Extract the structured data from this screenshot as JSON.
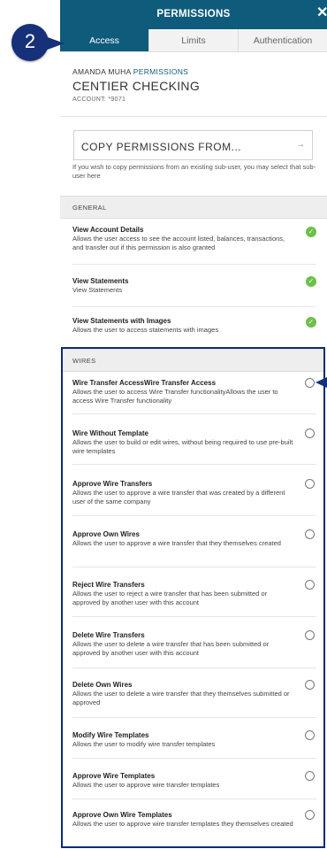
{
  "header": {
    "title": "PERMISSIONS",
    "close_glyph": "✕"
  },
  "tabs": [
    {
      "label": "Access",
      "active": true
    },
    {
      "label": "Limits",
      "active": false
    },
    {
      "label": "Authentication",
      "active": false
    }
  ],
  "user": {
    "name": "AMANDA MUHA",
    "permissions_word": "PERMISSIONS"
  },
  "account": {
    "name": "CENTIER CHECKING",
    "number": "ACCOUNT: *9071"
  },
  "copy": {
    "label": "COPY PERMISSIONS FROM...",
    "arrow": "→",
    "help": "If you wish to copy permissions from an existing sub-user, you may select that sub-user here"
  },
  "sections": {
    "general": {
      "title": "GENERAL",
      "items": [
        {
          "title": "View Account Details",
          "desc": "Allows the user access to see the account listed, balances, transactions, and transfer out if this permission is also granted",
          "checked": true
        },
        {
          "title": "View Statements",
          "desc": "View Statements",
          "checked": true
        },
        {
          "title": "View Statements with Images",
          "desc": "Allows the user to access statements with images",
          "checked": true
        }
      ]
    },
    "wires": {
      "title": "WIRES",
      "items": [
        {
          "title": "Wire Transfer AccessWire Transfer Access",
          "desc": "Allows the user to access Wire Transfer functionalityAllows the user to access Wire Transfer functionality",
          "checked": false
        },
        {
          "title": "Wire Without Template",
          "desc": "Allows the user to build or edit wires, without being required to use pre-built wire templates",
          "checked": false
        },
        {
          "title": "Approve Wire Transfers",
          "desc": "Allows the user to approve a wire transfer that was created by a different user of the same company",
          "checked": false
        },
        {
          "title": "Approve Own Wires",
          "desc": "Allows the user to approve a wire transfer that they themselves created",
          "checked": false
        },
        {
          "title": "Reject Wire Transfers",
          "desc": "Allows the user to reject a wire transfer that has been submitted or approved by another user with this account",
          "checked": false
        },
        {
          "title": "Delete Wire Transfers",
          "desc": "Allows the user to delete a wire transfer that has been submitted or approved by another user with this account",
          "checked": false
        },
        {
          "title": "Delete Own Wires",
          "desc": "Allows the user to delete a wire transfer that they themselves submitted or approved",
          "checked": false
        },
        {
          "title": "Modify Wire Templates",
          "desc": "Allows the user to modify wire transfer templates",
          "checked": false
        },
        {
          "title": "Approve Wire Templates",
          "desc": "Allows the user to approve wire transfer templates",
          "checked": false
        },
        {
          "title": "Approve Own Wire Templates",
          "desc": "Allows the user to approve wire transfer templates they themselves created",
          "checked": false
        }
      ]
    }
  },
  "annotation": {
    "step_number": "2",
    "color": "#16307a"
  },
  "colors": {
    "brand": "#0f5b7b",
    "check": "#6cc04a",
    "highlight": "#0d2a7a"
  }
}
